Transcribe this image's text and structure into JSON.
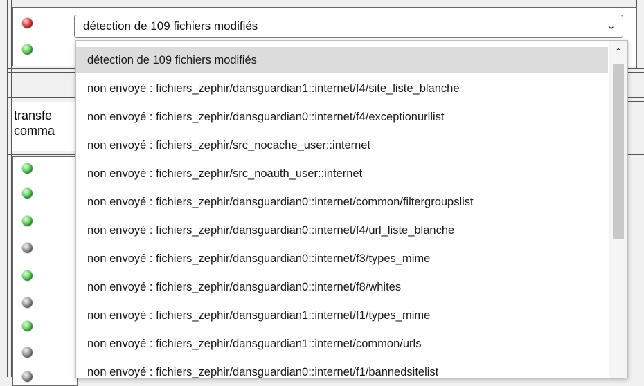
{
  "select": {
    "value": "détection de 109 fichiers modifiés",
    "chevron": "⌄"
  },
  "side": {
    "label_line1": "transfe",
    "label_line2": "comma"
  },
  "dropdown": {
    "options": [
      "détection de 109 fichiers modifiés",
      "non envoyé : fichiers_zephir/dansguardian1::internet/f4/site_liste_blanche",
      "non envoyé : fichiers_zephir/dansguardian0::internet/f4/exceptionurllist",
      "non envoyé : fichiers_zephir/src_nocache_user::internet",
      "non envoyé : fichiers_zephir/src_noauth_user::internet",
      "non envoyé : fichiers_zephir/dansguardian0::internet/common/filtergroupslist",
      "non envoyé : fichiers_zephir/dansguardian0::internet/f4/url_liste_blanche",
      "non envoyé : fichiers_zephir/dansguardian0::internet/f3/types_mime",
      "non envoyé : fichiers_zephir/dansguardian0::internet/f8/whites",
      "non envoyé : fichiers_zephir/dansguardian1::internet/f1/types_mime",
      "non envoyé : fichiers_zephir/dansguardian1::internet/common/urls",
      "non envoyé : fichiers_zephir/dansguardian0::internet/f1/bannedsitelist"
    ],
    "selected_index": 0
  },
  "status_lights": {
    "top": [
      "red",
      "green"
    ],
    "bottom": [
      "green",
      "green",
      "green",
      "gray",
      "green",
      "gray",
      "green",
      "gray",
      "gray"
    ]
  }
}
